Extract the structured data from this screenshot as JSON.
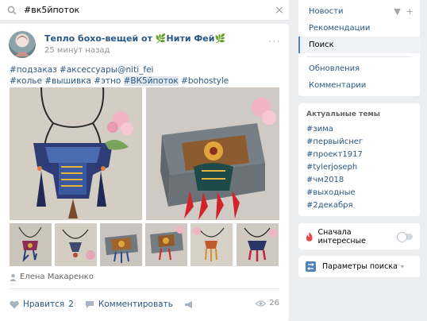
{
  "search": {
    "query": "#вк5йпоток",
    "placeholder": "Поиск"
  },
  "post": {
    "author": "Тепло бохо-вещей от",
    "author_suffix": "Нити Фей",
    "time": "25 минут назад",
    "more": "···",
    "text_line1": "#подзаказ #аксессуары@niti_fei",
    "text_line2_a": "#колье #вышивка #этно ",
    "text_line2_hl": "#ВК5йпоток",
    "text_line2_b": " #bohostyle",
    "owner": "Елена Макаренко",
    "likes_label": "Нравится",
    "likes_count": "2",
    "comment_label": "Комментировать",
    "views": "26"
  },
  "menu": {
    "items": [
      {
        "label": "Новости"
      },
      {
        "label": "Рекомендации"
      },
      {
        "label": "Поиск"
      },
      {
        "label": "Обновления"
      },
      {
        "label": "Комментарии"
      }
    ]
  },
  "topics": {
    "title": "Актуальные темы",
    "items": [
      "#зима",
      "#первыйснег",
      "#проект1917",
      "#tylerjoseph",
      "#чм2018",
      "#выходные",
      "#2декабря"
    ]
  },
  "interest": {
    "label": "Сначала интересные"
  },
  "params": {
    "label": "Параметры поиска"
  },
  "colors": {
    "link": "#2a5885",
    "accent": "#5181b8",
    "background": "#edeef0"
  }
}
